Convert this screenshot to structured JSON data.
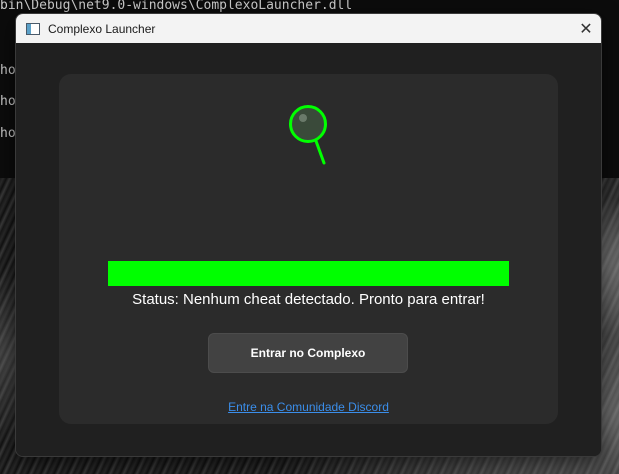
{
  "background": {
    "console_lines": [
      "bin\\Debug\\net9.0-windows\\ComplexoLauncher.dll",
      "ho",
      "ho",
      "ho"
    ]
  },
  "window": {
    "title": "Complexo Launcher",
    "close_glyph": "✕",
    "icon": "app-window-icon"
  },
  "scanner": {
    "icon": "magnifier-icon",
    "accent_color": "#00ff00",
    "progress_fraction": 1.0
  },
  "status": {
    "text": "Status: Nenhum cheat detectado. Pronto para entrar!"
  },
  "actions": {
    "enter_label": "Entrar no Complexo",
    "discord_link": "Entre na Comunidade Discord"
  }
}
